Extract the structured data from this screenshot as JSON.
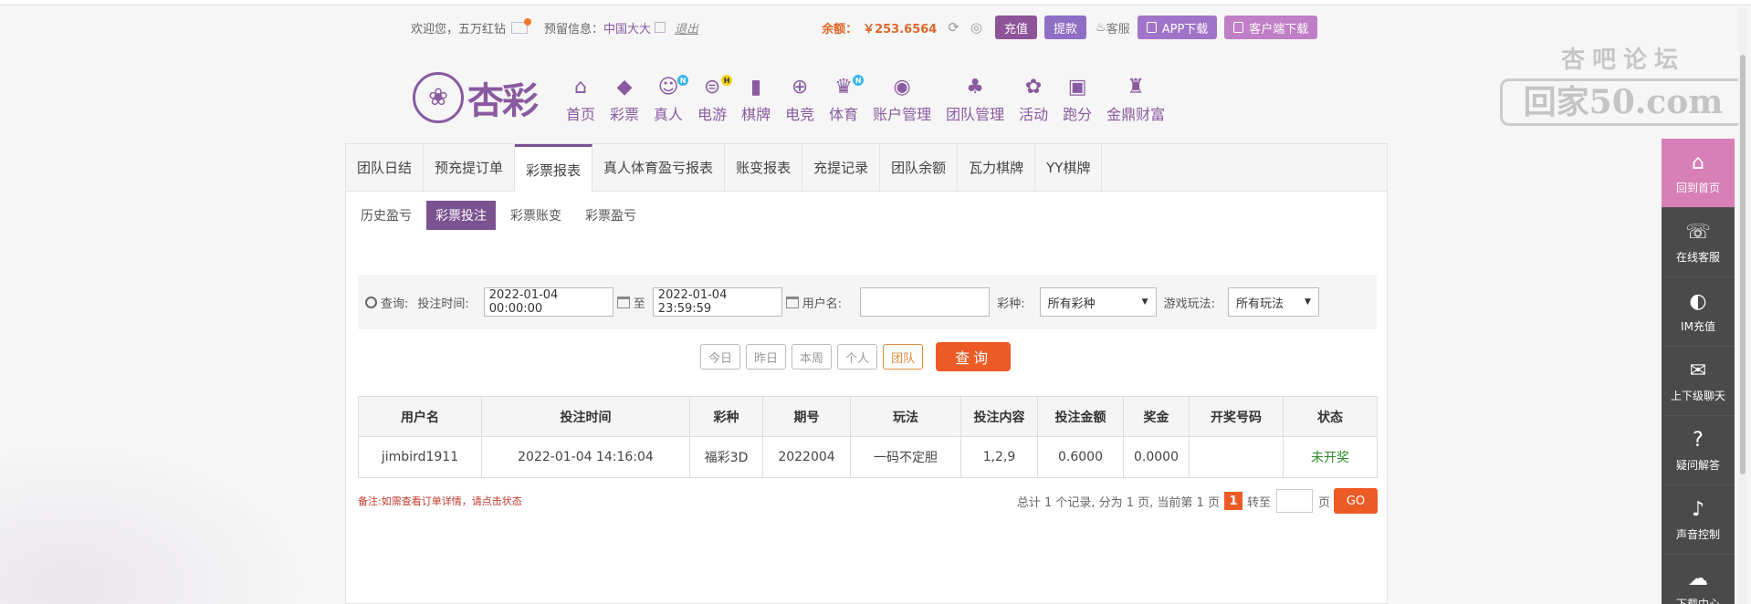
{
  "topbar": {
    "welcome": "欢迎您，五万红钻",
    "reserved_label": "预留信息：",
    "reserved_value": "中国大大",
    "logout": "退出",
    "balance_label": "余额：",
    "balance_value": "￥253.6564",
    "recharge": "充值",
    "withdraw": "提款",
    "customer_service": "客服",
    "app_download": "APP下载",
    "pc_download": "客户端下载"
  },
  "logo": {
    "text": "杏彩"
  },
  "nav": [
    {
      "label": "首页",
      "icon": "⌂",
      "badge": ""
    },
    {
      "label": "彩票",
      "icon": "◆",
      "badge": ""
    },
    {
      "label": "真人",
      "icon": "☺",
      "badge": "N"
    },
    {
      "label": "电游",
      "icon": "⊜",
      "badge": "H"
    },
    {
      "label": "棋牌",
      "icon": "▮",
      "badge": ""
    },
    {
      "label": "电竞",
      "icon": "⊕",
      "badge": ""
    },
    {
      "label": "体育",
      "icon": "♛",
      "badge": "N"
    },
    {
      "label": "账户管理",
      "icon": "◉",
      "badge": ""
    },
    {
      "label": "团队管理",
      "icon": "♣",
      "badge": ""
    },
    {
      "label": "活动",
      "icon": "✿",
      "badge": ""
    },
    {
      "label": "跑分",
      "icon": "▣",
      "badge": ""
    },
    {
      "label": "金鼎财富",
      "icon": "♜",
      "badge": ""
    }
  ],
  "watermark": {
    "top": "杏吧论坛",
    "bottom": "回家50.com"
  },
  "sidebar": [
    {
      "label": "回到首页",
      "icon": "⌂"
    },
    {
      "label": "在线客服",
      "icon": "☏"
    },
    {
      "label": "IM充值",
      "icon": "◐"
    },
    {
      "label": "上下级聊天",
      "icon": "✉"
    },
    {
      "label": "疑问解答",
      "icon": "?"
    },
    {
      "label": "声音控制",
      "icon": "♪"
    },
    {
      "label": "下载中心",
      "icon": "☁"
    }
  ],
  "tabs": [
    "团队日结",
    "预充提订单",
    "彩票报表",
    "真人体育盈亏报表",
    "账变报表",
    "充提记录",
    "团队余额",
    "瓦力棋牌",
    "YY棋牌"
  ],
  "subtabs": [
    "历史盈亏",
    "彩票投注",
    "彩票账变",
    "彩票盈亏"
  ],
  "query": {
    "search_label": "查询:",
    "time_label": "投注时间:",
    "start_time": "2022-01-04 00:00:00",
    "to": "至",
    "end_time": "2022-01-04 23:59:59",
    "user_label": "用户名:",
    "user_value": "",
    "lottery_label": "彩种:",
    "lottery_value": "所有彩种",
    "play_label": "游戏玩法:",
    "play_value": "所有玩法"
  },
  "quick_buttons": [
    "今日",
    "昨日",
    "本周",
    "个人",
    "团队"
  ],
  "query_button": "查询",
  "table": {
    "headers": [
      "用户名",
      "投注时间",
      "彩种",
      "期号",
      "玩法",
      "投注内容",
      "投注金额",
      "奖金",
      "开奖号码",
      "状态"
    ],
    "rows": [
      [
        "jimbird1911",
        "2022-01-04 14:16:04",
        "福彩3D",
        "2022004",
        "一码不定胆",
        "1,2,9",
        "0.6000",
        "0.0000",
        "",
        "未开奖"
      ]
    ]
  },
  "note": "备注:如需查看订单详情，请点击状态",
  "pager": {
    "summary": "总计 1 个记录, 分为 1 页, 当前第 1 页",
    "current": "1",
    "goto": "转至",
    "page_unit": "页",
    "go": "GO"
  }
}
